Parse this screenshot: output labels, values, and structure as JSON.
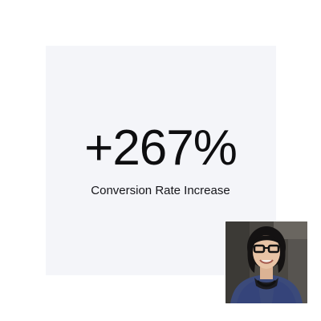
{
  "stat": {
    "value": "+267%",
    "label": "Conversion Rate Increase"
  },
  "portrait": {
    "icon": "person-photo",
    "background_color": "#4a4742",
    "jacket_color": "#3b4a7a",
    "hair_color": "#141212",
    "skin_color": "#e7c3a5"
  },
  "colors": {
    "page_background": "#ffffff",
    "card_background": "#f4f5f9",
    "text": "#0e0e10"
  }
}
